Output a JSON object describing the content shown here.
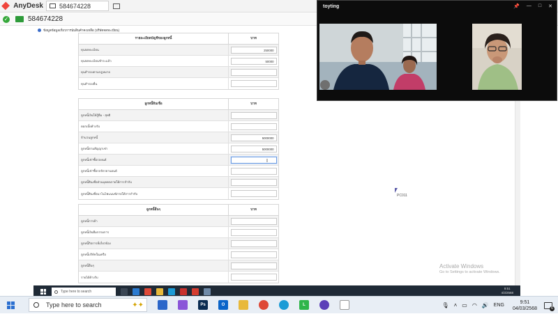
{
  "anydesk": {
    "app_name": "AnyDesk",
    "tab_label": "584674228",
    "address": "584674228",
    "controls": [
      "–",
      "□",
      "×"
    ]
  },
  "form": {
    "page_title": "ข้อมูลข้อมูลเกี่ยวการนับสินค้าคงเหลือ (บริษัทจดทะเบียน)",
    "section1": {
      "header": "รายละเอียดบัญชีของลูกหนี้",
      "value_header": "บาท",
      "rows": [
        {
          "label": "ทุนจดทะเบียน",
          "value": "250000"
        },
        {
          "label": "ทุนจดทะเบียนชำระแล้ว",
          "value": "50000"
        },
        {
          "label": "ทุนสำรองตามกฎหมาย",
          "value": ""
        },
        {
          "label": "ทุนสำรองอื่น",
          "value": ""
        }
      ]
    },
    "section2": {
      "header": "ลูกหนี้สินเชื่อ",
      "value_header": "บาท",
      "rows": [
        {
          "label": "ลูกหนี้เงินให้กู้ยืม - สุทธิ",
          "value": ""
        },
        {
          "label": "ดอกเบี้ยค้างรับ",
          "value": ""
        },
        {
          "label": "จำนวนลูกหนี้",
          "value": "5000000"
        },
        {
          "label": "ลูกหนี้ตามสัญญาเช่า",
          "value": "5000000"
        },
        {
          "label": "ลูกหนี้เช่าซื้อรถยนต์",
          "value": ""
        },
        {
          "label": "ลูกหนี้เช่าซื้อรถจักรยานยนต์",
          "value": ""
        },
        {
          "label": "ลูกหนี้สินเชื่อส่วนบุคคลภายใต้การกำกับ",
          "value": ""
        },
        {
          "label": "ลูกหนี้สินเชื่อนาโนไฟแนนซ์ภายใต้การกำกับ",
          "value": ""
        }
      ]
    },
    "section3": {
      "header": "ลูกหนี้อื่นๆ",
      "value_header": "บาท",
      "rows": [
        {
          "label": "ลูกหนี้การค้า",
          "value": ""
        },
        {
          "label": "ลูกหนี้เงินยืมกรรมการ",
          "value": ""
        },
        {
          "label": "ลูกหนี้กิจการที่เกี่ยวข้อง",
          "value": ""
        },
        {
          "label": "ลูกหนี้บริษัทในเครือ",
          "value": ""
        },
        {
          "label": "ลูกหนี้อื่นๆ",
          "value": ""
        },
        {
          "label": "รายได้ค้างรับ",
          "value": ""
        }
      ]
    },
    "cursor_label": "PC011",
    "activate_windows": "Activate Windows",
    "activate_windows_sub": "Go to Settings to activate Windows."
  },
  "remote_taskbar": {
    "search_placeholder": "Type here to search",
    "time": "9:51",
    "date": "4/3/2568"
  },
  "video_call": {
    "title": "toyting",
    "controls": [
      "📌",
      "—",
      "□",
      "✕"
    ]
  },
  "host_taskbar": {
    "search_placeholder": "Type here to search",
    "language": "ENG",
    "time": "9:51",
    "date": "04/03/2568",
    "notification_count": "6",
    "apps": [
      {
        "name": "task-view-icon",
        "color": "#2b66c9",
        "glyph": ""
      },
      {
        "name": "copilot-icon",
        "color": "#8a55d8",
        "glyph": ""
      },
      {
        "name": "photoshop-icon",
        "color": "#0a2c52",
        "glyph": "Ps"
      },
      {
        "name": "outlook-icon",
        "color": "#0a64c9",
        "glyph": "O"
      },
      {
        "name": "file-explorer-icon",
        "color": "#e8b93a",
        "glyph": ""
      },
      {
        "name": "chrome-icon",
        "color": "#de4937",
        "glyph": ""
      },
      {
        "name": "edge-icon",
        "color": "#1b9bd6",
        "glyph": ""
      },
      {
        "name": "line-icon",
        "color": "#2fb54a",
        "glyph": "L"
      },
      {
        "name": "firefox-icon",
        "color": "#5b3fb8",
        "glyph": ""
      },
      {
        "name": "notepad-icon",
        "color": "#ffffff",
        "glyph": ""
      }
    ]
  }
}
